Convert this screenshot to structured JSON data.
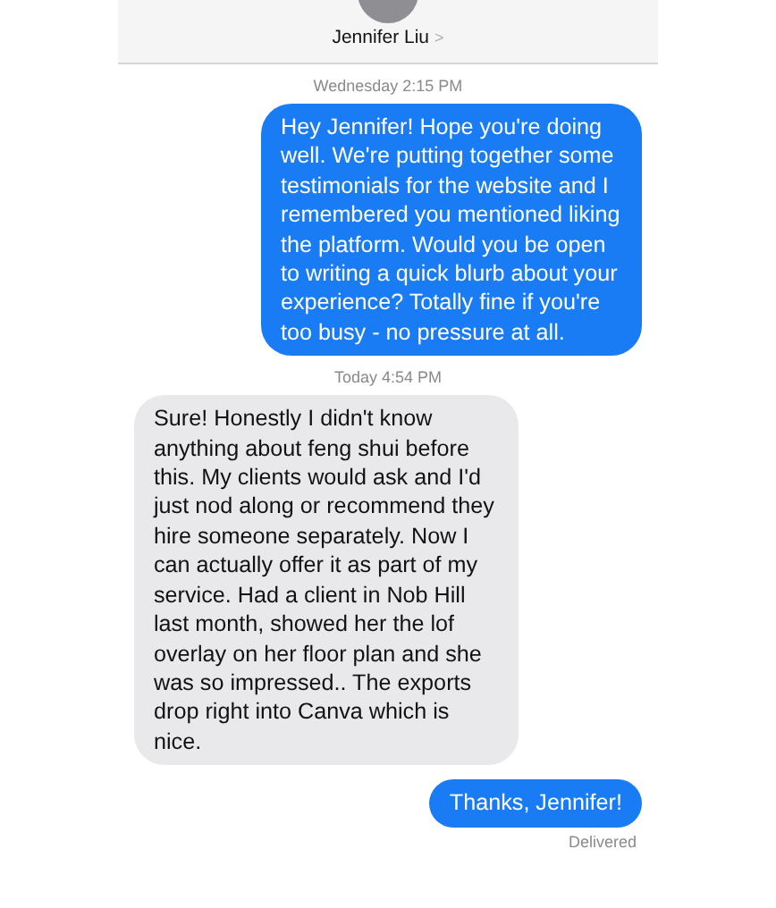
{
  "header": {
    "contact_name": "Jennifer Liu",
    "chevron": ">"
  },
  "messages": [
    {
      "kind": "timestamp",
      "text": "Wednesday 2:15 PM"
    },
    {
      "kind": "sent",
      "text": "Hey Jennifer! Hope you're doing well. We're putting together some testimonials for the website and I remembered you mentioned liking the platform. Would you be open to writing a quick blurb about your experience? Totally fine if you're too busy - no pressure at all."
    },
    {
      "kind": "timestamp",
      "text": "Today 4:54 PM"
    },
    {
      "kind": "received",
      "text": "Sure! Honestly I didn't know anything about feng shui before this. My clients would ask and I'd just nod along or recommend they hire someone separately. Now I can actually offer it as part of my service. Had a client in Nob Hill last month, showed her the lof overlay on her floor plan and she was so impressed.. The exports drop right into Canva which is nice."
    },
    {
      "kind": "sent",
      "text": "Thanks, Jennifer!"
    },
    {
      "kind": "status",
      "text": "Delivered"
    }
  ]
}
